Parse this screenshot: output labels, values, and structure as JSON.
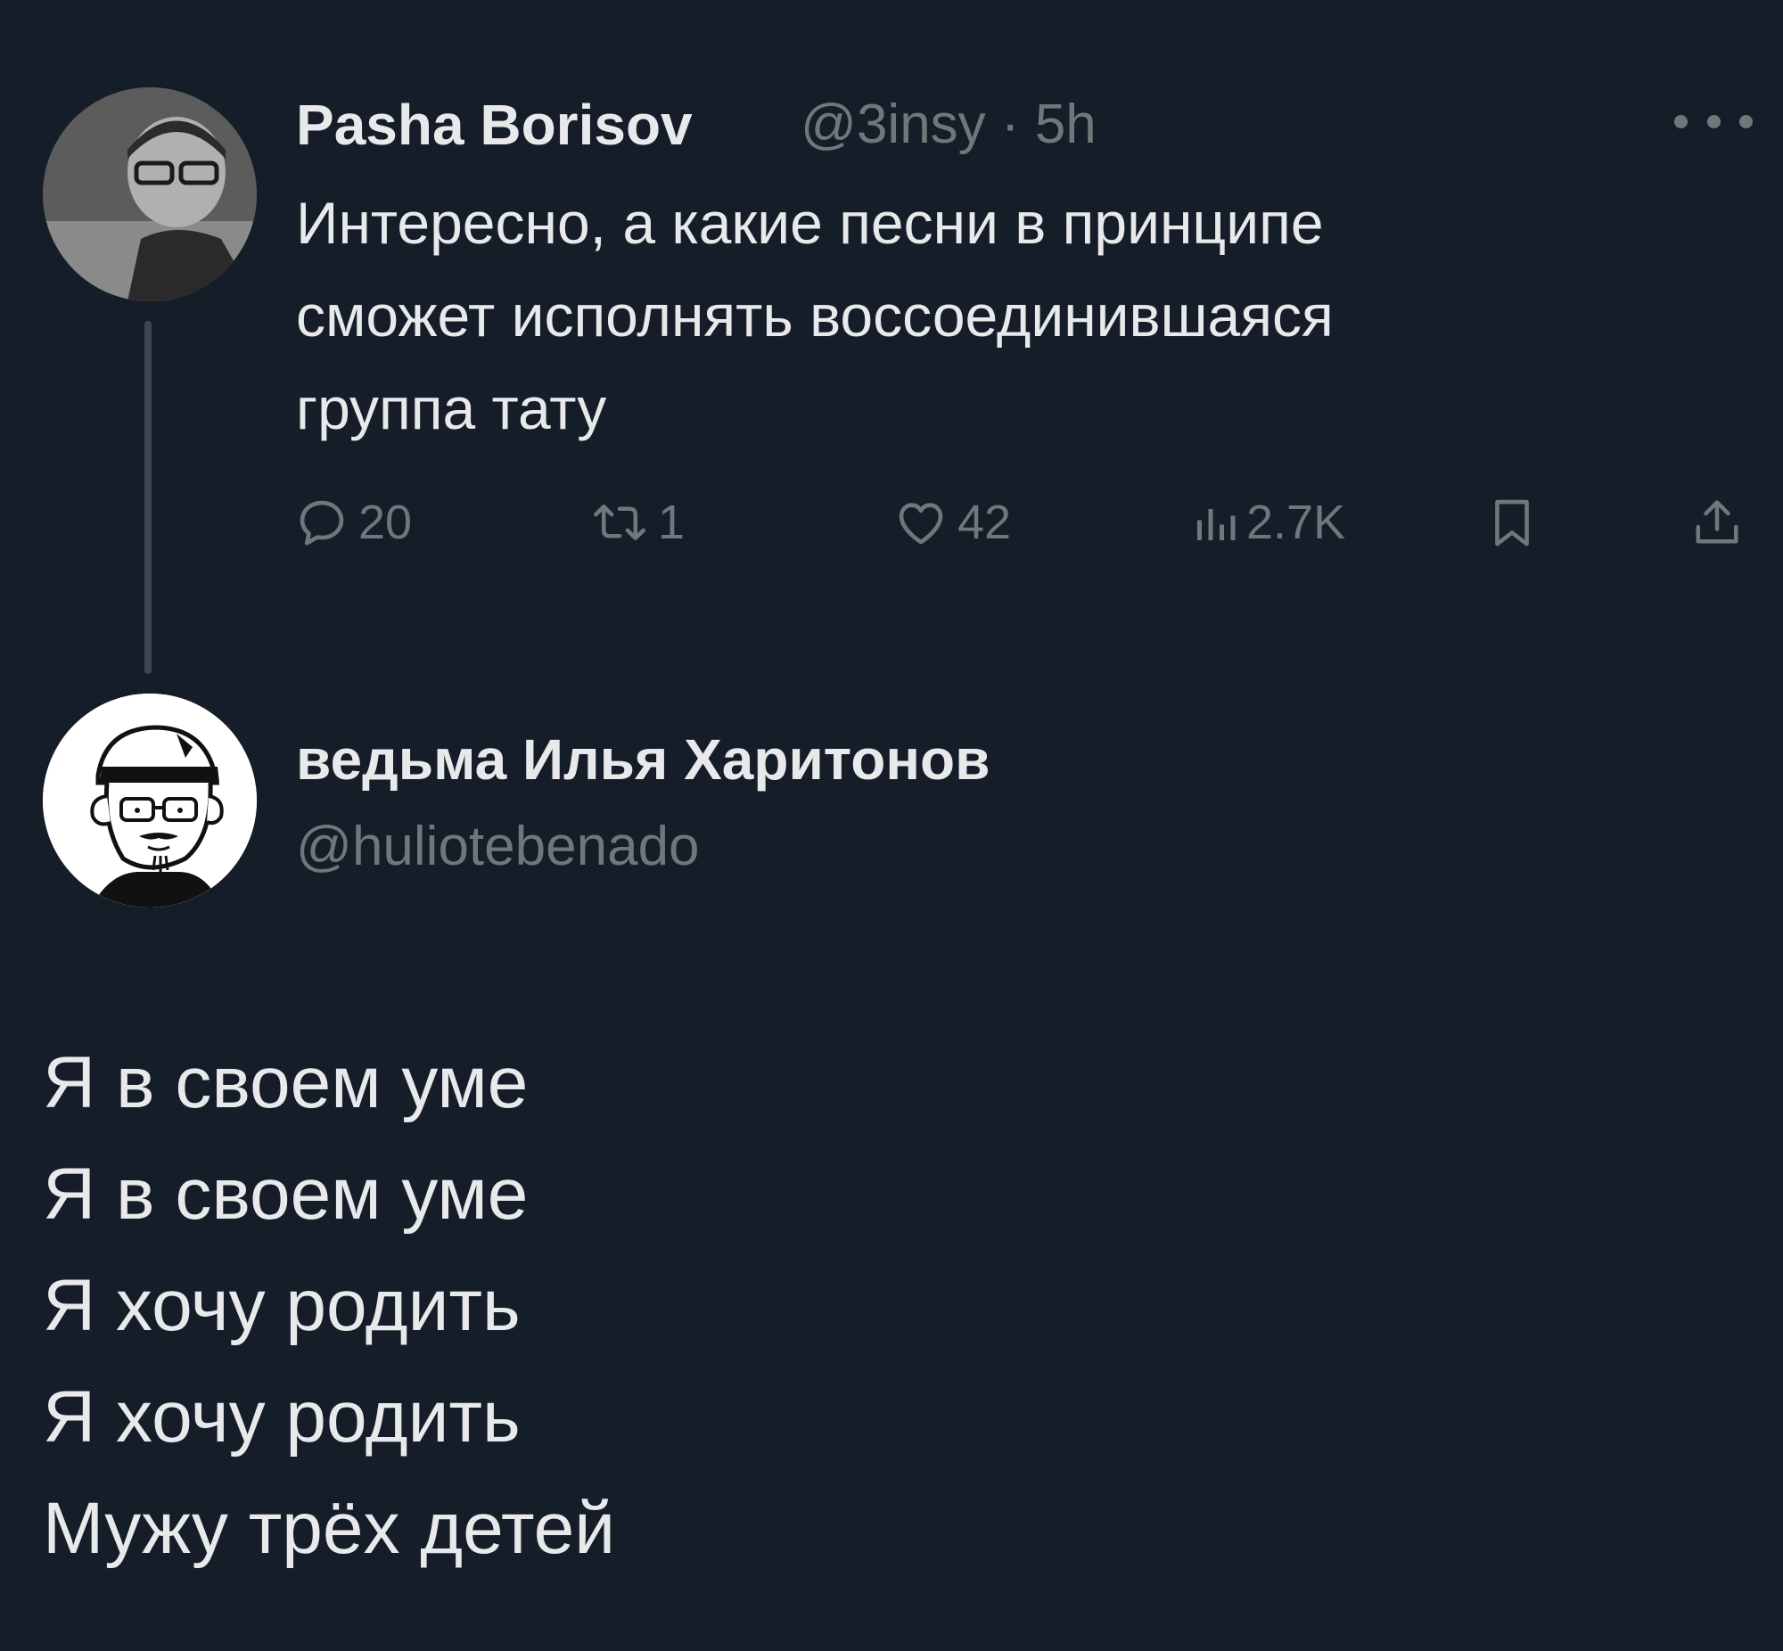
{
  "tweets": [
    {
      "author": "Pasha Borisov",
      "handle": "@3insy",
      "separator": "·",
      "time": "5h",
      "more_icon": "more-horizontal-icon",
      "text": "Интересно, а какие песни в принципе\nсможет исполнять воссоединившаяся\nгруппа тату",
      "actions": {
        "reply": {
          "icon": "reply-icon",
          "count": "20"
        },
        "retweet": {
          "icon": "retweet-icon",
          "count": "1"
        },
        "like": {
          "icon": "heart-icon",
          "count": "42"
        },
        "views": {
          "icon": "views-icon",
          "count": "2.7K"
        },
        "bookmark": {
          "icon": "bookmark-icon"
        },
        "share": {
          "icon": "share-icon"
        }
      }
    },
    {
      "author": "ведьма Илья Харитонов",
      "handle": "@huliotebenado",
      "text": "Я в своем уме\nЯ в своем уме\nЯ хочу родить\nЯ хочу родить\nМужу трёх детей"
    }
  ],
  "colors": {
    "background": "#151d28",
    "text_primary": "#e7e9ea",
    "text_secondary": "#71767b",
    "thread_line": "#3a4654"
  }
}
